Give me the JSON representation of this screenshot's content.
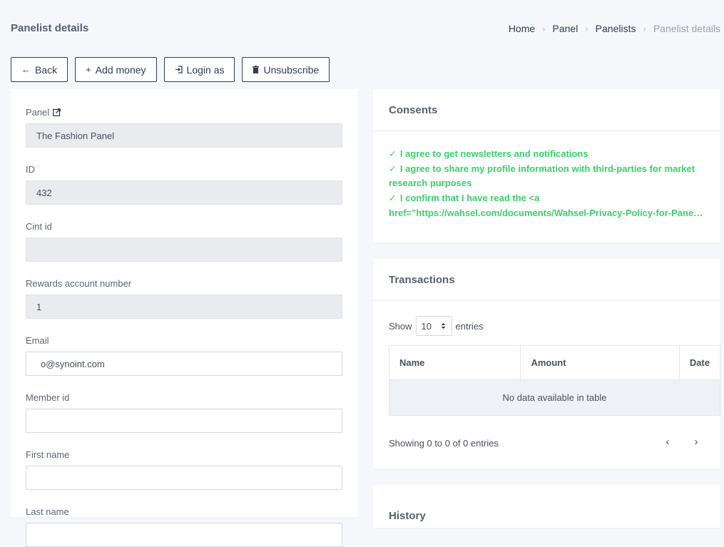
{
  "page": {
    "title": "Panelist details"
  },
  "breadcrumb": [
    "Home",
    "Panel",
    "Panelists",
    "Panelist details"
  ],
  "actions": {
    "back": "Back",
    "add_money": "Add money",
    "login_as": "Login as",
    "unsubscribe": "Unsubscribe"
  },
  "form": {
    "panel": {
      "label": "Panel",
      "value": "The Fashion Panel"
    },
    "id": {
      "label": "ID",
      "value": "432"
    },
    "cint_id": {
      "label": "Cint id",
      "value": ""
    },
    "rewards": {
      "label": "Rewards account number",
      "value": "1"
    },
    "email": {
      "label": "Email",
      "value": "o@synoint.com"
    },
    "member_id": {
      "label": "Member id",
      "value": ""
    },
    "first_name": {
      "label": "First name",
      "value": ""
    },
    "last_name": {
      "label": "Last name",
      "value": ""
    }
  },
  "consents": {
    "title": "Consents",
    "items": [
      "I agree to get newsletters and notifications",
      "I agree to share my profile information with third-parties for market research purposes",
      "I confirm that I have read the <a",
      "href=\"https://wahsel.com/documents/Wahsel-Privacy-Policy-for-Panelists.pdf\""
    ]
  },
  "transactions": {
    "title": "Transactions",
    "show_label": "Show",
    "entries_label": "entries",
    "page_size": "10",
    "columns": [
      "Name",
      "Amount",
      "Date"
    ],
    "empty": "No data available in table",
    "info": "Showing 0 to 0 of 0 entries",
    "prev": "‹",
    "next": "›"
  },
  "history": {
    "title": "History"
  },
  "colors": {
    "accent": "#2f3d56",
    "success": "#3ccf6a",
    "readonly_bg": "#e9ebee"
  }
}
